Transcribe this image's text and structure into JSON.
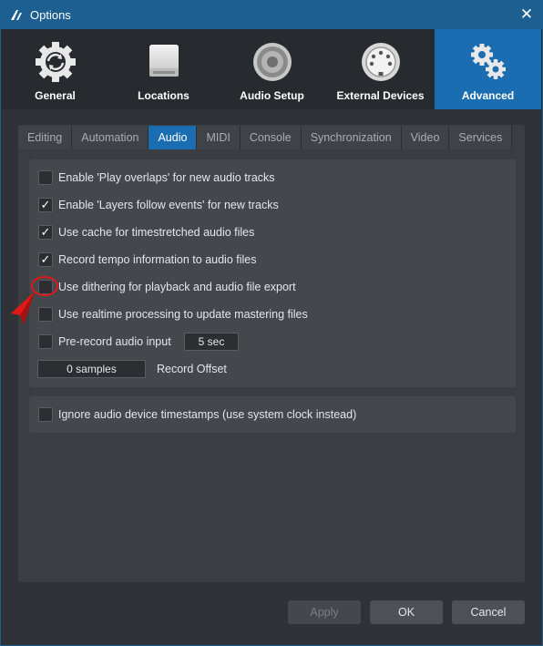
{
  "window": {
    "title": "Options"
  },
  "categories": [
    {
      "label": "General",
      "icon": "refresh-gear-icon",
      "active": false
    },
    {
      "label": "Locations",
      "icon": "drive-icon",
      "active": false
    },
    {
      "label": "Audio Setup",
      "icon": "speaker-icon",
      "active": false
    },
    {
      "label": "External Devices",
      "icon": "midi-connector-icon",
      "active": false
    },
    {
      "label": "Advanced",
      "icon": "gears-icon",
      "active": true
    }
  ],
  "tabs": [
    {
      "label": "Editing"
    },
    {
      "label": "Automation"
    },
    {
      "label": "Audio"
    },
    {
      "label": "MIDI"
    },
    {
      "label": "Console"
    },
    {
      "label": "Synchronization"
    },
    {
      "label": "Video"
    },
    {
      "label": "Services"
    }
  ],
  "active_tab": "Audio",
  "audio": {
    "options": [
      {
        "label": "Enable 'Play overlaps' for new audio tracks",
        "checked": false
      },
      {
        "label": "Enable 'Layers follow events' for new tracks",
        "checked": true
      },
      {
        "label": "Use cache for timestretched audio files",
        "checked": true
      },
      {
        "label": "Record tempo information to audio files",
        "checked": true
      },
      {
        "label": "Use dithering for playback and audio file export",
        "checked": false
      },
      {
        "label": "Use realtime processing to update mastering files",
        "checked": false
      },
      {
        "label": "Pre-record audio input",
        "checked": false
      }
    ],
    "prerecord_value": "5 sec",
    "record_offset_value": "0 samples",
    "record_offset_label": "Record Offset",
    "ignore_timestamps": {
      "label": "Ignore audio device timestamps (use system clock instead)",
      "checked": false
    }
  },
  "buttons": {
    "apply": "Apply",
    "ok": "OK",
    "cancel": "Cancel"
  },
  "check_glyph": "✓",
  "colors": {
    "accent": "#1a6db0",
    "titlebar": "#1d5f90",
    "annotation": "#e11818"
  }
}
